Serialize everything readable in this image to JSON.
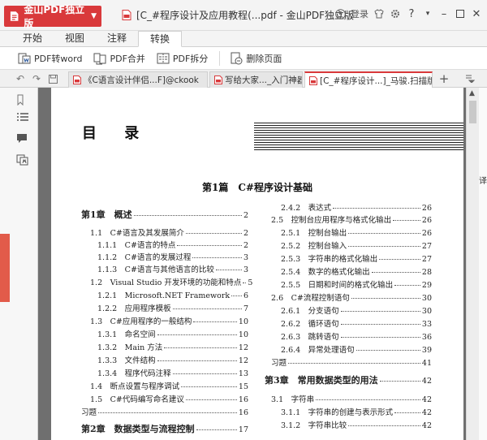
{
  "app": {
    "brand_name": "金山PDF独立版",
    "window_title": "[C_#程序设计及应用教程(...pdf - 金山PDF独立版",
    "login_label": "登录",
    "accent_color": "#d9393b"
  },
  "menu_tabs": [
    {
      "label": "开始"
    },
    {
      "label": "视图"
    },
    {
      "label": "注释"
    },
    {
      "label": "转换"
    }
  ],
  "active_menu_tab": "转换",
  "ribbon": {
    "pdf_to_word": "PDF转word",
    "pdf_merge": "PDF合并",
    "pdf_split": "PDF拆分",
    "delete_page": "删除页面"
  },
  "doc_tabs": [
    {
      "label": "《C语言设计伴侣...F]@ckook"
    },
    {
      "label": "写给大家..._入门神器"
    },
    {
      "label": "[C_#程序设计...]_马骏.扫描版"
    }
  ],
  "page": {
    "title": "目 录",
    "part_title": "第1篇　C#程序设计基础",
    "left_entries": [
      {
        "text": "第1章　概述",
        "page": "2"
      },
      {
        "text": "1.1　C#语言及其发展简介",
        "page": "2"
      },
      {
        "text": "1.1.1　C#语言的特点",
        "page": "2"
      },
      {
        "text": "1.1.2　C#语言的发展过程",
        "page": "3"
      },
      {
        "text": "1.1.3　C#语言与其他语言的比较",
        "page": "3"
      },
      {
        "text": "1.2　Visual Studio 开发环境的功能和特点",
        "page": "5"
      },
      {
        "text": "1.2.1　Microsoft.NET Framework",
        "page": "6"
      },
      {
        "text": "1.2.2　应用程序模板",
        "page": "7"
      },
      {
        "text": "1.3　C#应用程序的一般结构",
        "page": "10"
      },
      {
        "text": "1.3.1　命名空间",
        "page": "10"
      },
      {
        "text": "1.3.2　Main 方法",
        "page": "12"
      },
      {
        "text": "1.3.3　文件结构",
        "page": "12"
      },
      {
        "text": "1.3.4　程序代码注释",
        "page": "13"
      },
      {
        "text": "1.4　断点设置与程序调试",
        "page": "15"
      },
      {
        "text": "1.5　C#代码编写命名建议",
        "page": "16"
      },
      {
        "text": "习题",
        "page": "16"
      },
      {
        "text": "第2章　数据类型与流程控制",
        "page": "17"
      }
    ],
    "right_entries": [
      {
        "text": "2.4.2　表达式",
        "page": "26"
      },
      {
        "text": "2.5　控制台应用程序与格式化输出",
        "page": "26"
      },
      {
        "text": "2.5.1　控制台输出",
        "page": "26"
      },
      {
        "text": "2.5.2　控制台输入",
        "page": "27"
      },
      {
        "text": "2.5.3　字符串的格式化输出",
        "page": "27"
      },
      {
        "text": "2.5.4　数字的格式化输出",
        "page": "28"
      },
      {
        "text": "2.5.5　日期和时间的格式化输出",
        "page": "29"
      },
      {
        "text": "2.6　C#流程控制语句",
        "page": "30"
      },
      {
        "text": "2.6.1　分支语句",
        "page": "30"
      },
      {
        "text": "2.6.2　循环语句",
        "page": "33"
      },
      {
        "text": "2.6.3　跳转语句",
        "page": "36"
      },
      {
        "text": "2.6.4　异常处理语句",
        "page": "39"
      },
      {
        "text": "习题",
        "page": "41"
      },
      {
        "text": "第3章　常用数据类型的用法",
        "page": "42"
      },
      {
        "text": "3.1　字符串",
        "page": "42"
      },
      {
        "text": "3.1.1　字符串的创建与表示形式",
        "page": "42"
      },
      {
        "text": "3.1.2　字符串比较",
        "page": "42"
      }
    ]
  },
  "right_strip_char": "译"
}
